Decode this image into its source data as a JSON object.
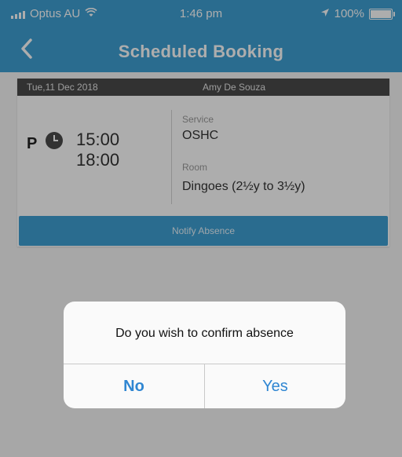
{
  "status_bar": {
    "carrier": "Optus AU",
    "time": "1:46 pm",
    "battery": "100%",
    "icons": [
      "signal-icon",
      "wifi-icon",
      "location-icon",
      "battery-icon"
    ]
  },
  "nav": {
    "back_icon": "chevron-left-icon",
    "title": "Scheduled Booking"
  },
  "booking": {
    "date": "Tue,11 Dec 2018",
    "child_name": "Amy De Souza",
    "status_letter": "P",
    "start_time": "15:00",
    "end_time": "18:00",
    "service_label": "Service",
    "service_value": "OSHC",
    "room_label": "Room",
    "room_value": "Dingoes (2½y to 3½y)",
    "notify_button": "Notify Absence"
  },
  "dialog": {
    "message": "Do you wish to confirm absence",
    "no_label": "No",
    "yes_label": "Yes"
  },
  "colors": {
    "accent": "#3f9fd3",
    "header_bar": "#4b4b4b",
    "dialog_button": "#2f86d2"
  }
}
